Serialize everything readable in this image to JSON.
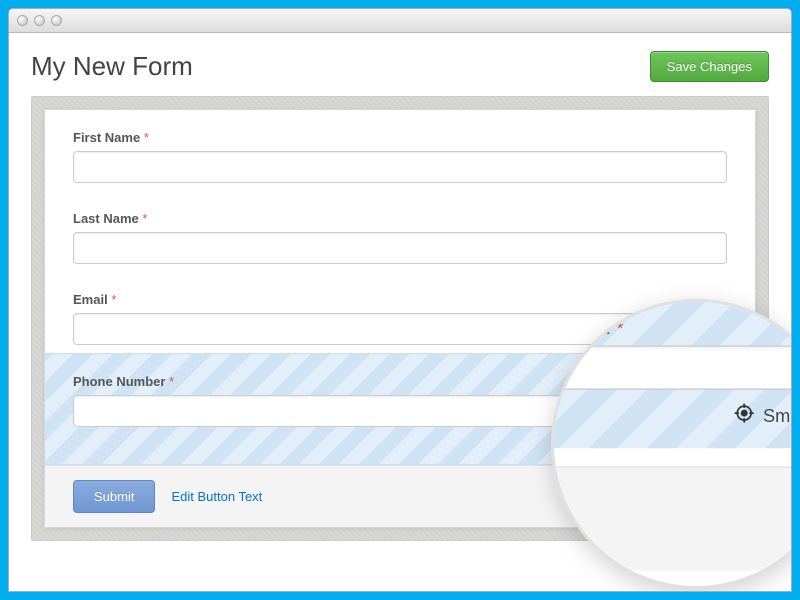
{
  "header": {
    "title": "My New Form",
    "save_button": "Save Changes"
  },
  "fields": {
    "first_name": {
      "label": "First Name",
      "required": true,
      "value": ""
    },
    "last_name": {
      "label": "Last Name",
      "required": true,
      "value": ""
    },
    "email": {
      "label": "Email",
      "required": true,
      "value": ""
    },
    "phone": {
      "label": "Phone Number",
      "required": true,
      "value": "",
      "smart_field_label": "Smart Field"
    }
  },
  "footer": {
    "submit_label": "Submit",
    "edit_button_text_link": "Edit Button Text"
  },
  "required_marker": "*"
}
